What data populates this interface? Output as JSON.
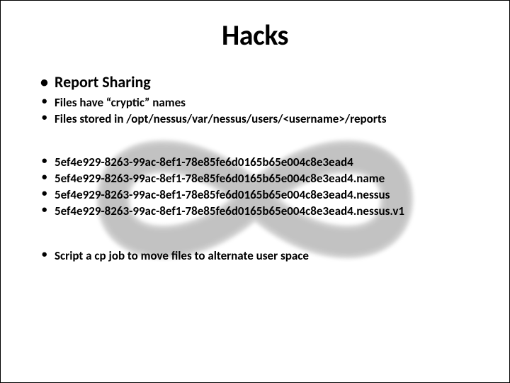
{
  "title": "Hacks",
  "section1": {
    "heading": "Report Sharing",
    "items": [
      "Files have “cryptic” names",
      "Files stored in /opt/nessus/var/nessus/users/<username>/reports"
    ]
  },
  "section2": {
    "items": [
      "5ef4e929-8263-99ac-8ef1-78e85fe6d0165b65e004c8e3ead4",
      "5ef4e929-8263-99ac-8ef1-78e85fe6d0165b65e004c8e3ead4.name",
      "5ef4e929-8263-99ac-8ef1-78e85fe6d0165b65e004c8e3ead4.nessus",
      "5ef4e929-8263-99ac-8ef1-78e85fe6d0165b65e004c8e3ead4.nessus.v1"
    ]
  },
  "section3": {
    "items": [
      "Script a cp job to move files to alternate user space"
    ]
  }
}
